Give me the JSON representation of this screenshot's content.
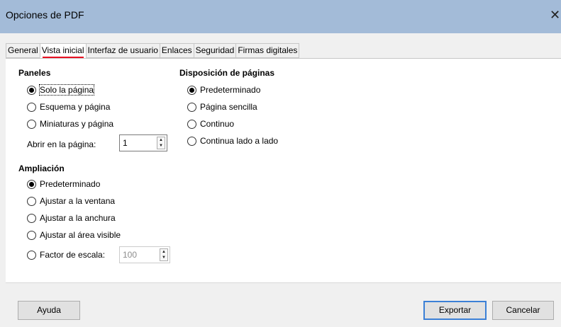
{
  "window": {
    "title": "Opciones de PDF",
    "close_glyph": "✕"
  },
  "tabs": [
    {
      "label": "General"
    },
    {
      "label": "Vista inicial"
    },
    {
      "label": "Interfaz de usuario"
    },
    {
      "label": "Enlaces"
    },
    {
      "label": "Seguridad"
    },
    {
      "label": "Firmas digitales"
    }
  ],
  "active_tab": "Vista inicial",
  "paneles": {
    "heading": "Paneles",
    "options": [
      {
        "label": "Solo la página",
        "selected": true
      },
      {
        "label": "Esquema y página",
        "selected": false
      },
      {
        "label": "Miniaturas y página",
        "selected": false
      }
    ],
    "open_page_label": "Abrir en la página:",
    "open_page_value": "1"
  },
  "ampliacion": {
    "heading": "Ampliación",
    "options": [
      {
        "label": "Predeterminado",
        "selected": true
      },
      {
        "label": "Ajustar a la ventana",
        "selected": false
      },
      {
        "label": "Ajustar a la anchura",
        "selected": false
      },
      {
        "label": "Ajustar al área visible",
        "selected": false
      },
      {
        "label": "Factor de escala:",
        "selected": false
      }
    ],
    "scale_value": "100"
  },
  "disposicion": {
    "heading": "Disposición de páginas",
    "options": [
      {
        "label": "Predeterminado",
        "selected": true
      },
      {
        "label": "Página sencilla",
        "selected": false
      },
      {
        "label": "Continuo",
        "selected": false
      },
      {
        "label": "Continua lado a lado",
        "selected": false
      }
    ]
  },
  "footer": {
    "help_label": "Ayuda",
    "export_label": "Exportar",
    "cancel_label": "Cancelar"
  },
  "colors": {
    "titlebar": "#a3bbd8",
    "active_tab_underline": "#e81123",
    "default_button_border": "#3c80d6"
  }
}
